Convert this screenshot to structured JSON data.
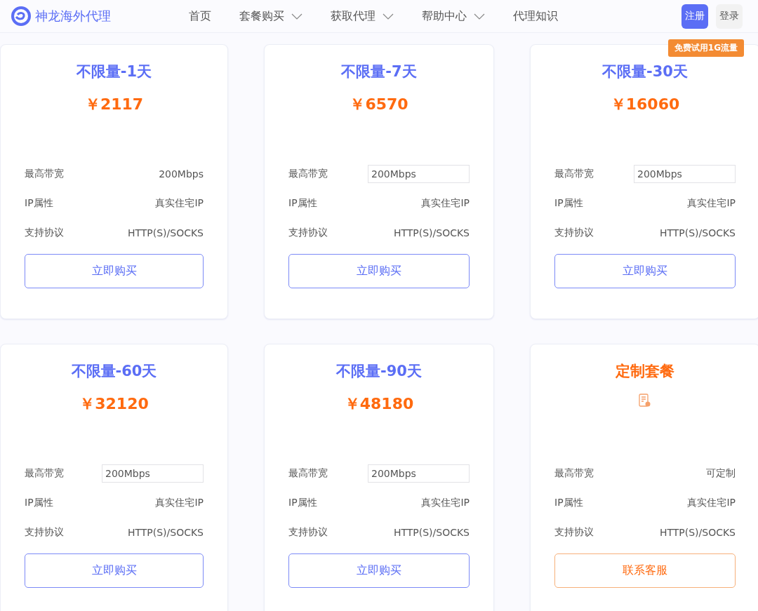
{
  "brand": {
    "name": "神龙海外代理"
  },
  "nav": [
    {
      "label": "首页",
      "dropdown": false
    },
    {
      "label": "套餐购买",
      "dropdown": true
    },
    {
      "label": "获取代理",
      "dropdown": true
    },
    {
      "label": "帮助中心",
      "dropdown": true
    },
    {
      "label": "代理知识",
      "dropdown": false
    }
  ],
  "auth": {
    "register": "注册",
    "login": "登录",
    "promo": "免费试用1G流量"
  },
  "plans": [
    {
      "kind": "plan",
      "title": "不限量-1天",
      "price": "￥2117",
      "features": [
        {
          "label": "最高带宽",
          "value": "200Mbps",
          "kind": "text"
        },
        {
          "label": "IP属性",
          "value": "真实住宅IP",
          "kind": "text"
        },
        {
          "label": "支持协议",
          "value": "HTTP(S)/SOCKS",
          "kind": "text"
        }
      ],
      "button": "立即购买"
    },
    {
      "kind": "plan",
      "title": "不限量-7天",
      "price": "￥6570",
      "features": [
        {
          "label": "最高带宽",
          "value": "200Mbps",
          "kind": "select"
        },
        {
          "label": "IP属性",
          "value": "真实住宅IP",
          "kind": "text"
        },
        {
          "label": "支持协议",
          "value": "HTTP(S)/SOCKS",
          "kind": "text"
        }
      ],
      "button": "立即购买"
    },
    {
      "kind": "plan",
      "title": "不限量-30天",
      "price": "￥16060",
      "features": [
        {
          "label": "最高带宽",
          "value": "200Mbps",
          "kind": "select"
        },
        {
          "label": "IP属性",
          "value": "真实住宅IP",
          "kind": "text"
        },
        {
          "label": "支持协议",
          "value": "HTTP(S)/SOCKS",
          "kind": "text"
        }
      ],
      "button": "立即购买"
    },
    {
      "kind": "plan",
      "title": "不限量-60天",
      "price": "￥32120",
      "features": [
        {
          "label": "最高带宽",
          "value": "200Mbps",
          "kind": "select"
        },
        {
          "label": "IP属性",
          "value": "真实住宅IP",
          "kind": "text"
        },
        {
          "label": "支持协议",
          "value": "HTTP(S)/SOCKS",
          "kind": "text"
        }
      ],
      "button": "立即购买"
    },
    {
      "kind": "plan",
      "title": "不限量-90天",
      "price": "￥48180",
      "features": [
        {
          "label": "最高带宽",
          "value": "200Mbps",
          "kind": "select"
        },
        {
          "label": "IP属性",
          "value": "真实住宅IP",
          "kind": "text"
        },
        {
          "label": "支持协议",
          "value": "HTTP(S)/SOCKS",
          "kind": "text"
        }
      ],
      "button": "立即购买"
    },
    {
      "kind": "custom",
      "title": "定制套餐",
      "features": [
        {
          "label": "最高带宽",
          "value": "可定制",
          "kind": "text"
        },
        {
          "label": "IP属性",
          "value": "真实住宅IP",
          "kind": "text"
        },
        {
          "label": "支持协议",
          "value": "HTTP(S)/SOCKS",
          "kind": "text"
        }
      ],
      "button": "联系客服"
    }
  ]
}
